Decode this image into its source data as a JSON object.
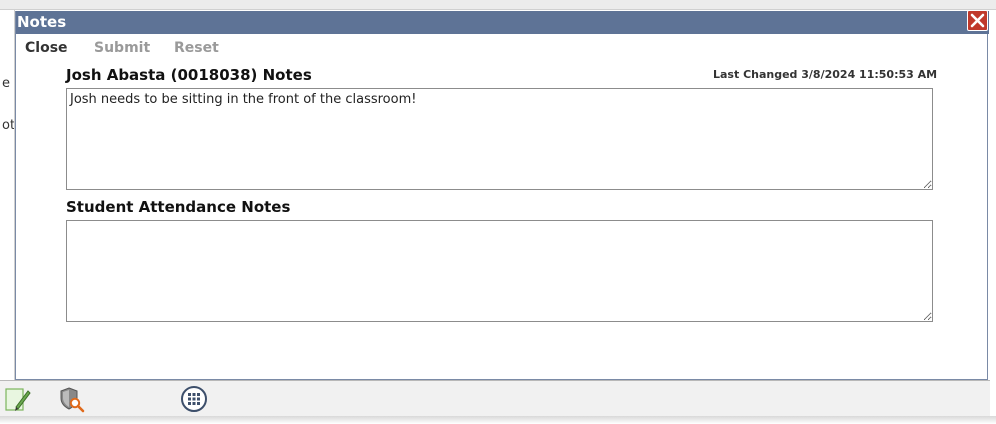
{
  "dialog": {
    "title": "Notes",
    "close_icon": "close-x-icon",
    "toolbar": {
      "close_label": "Close",
      "submit_label": "Submit",
      "reset_label": "Reset"
    },
    "student_notes": {
      "heading": "Josh Abasta (0018038) Notes",
      "last_changed": "Last Changed 3/8/2024 11:50:53 AM",
      "value": "Josh needs to be sitting in the front of the classroom!"
    },
    "attendance_notes": {
      "heading": "Student Attendance Notes",
      "value": ""
    }
  },
  "background": {
    "left_fragments": [
      "e",
      "ot"
    ],
    "bottom_icons": [
      "edit-note-icon",
      "security-search-icon",
      "grid-menu-icon"
    ]
  },
  "colors": {
    "titlebar": "#5e7396",
    "close_button": "#c0392b",
    "disabled_text": "#9a9a9a"
  }
}
